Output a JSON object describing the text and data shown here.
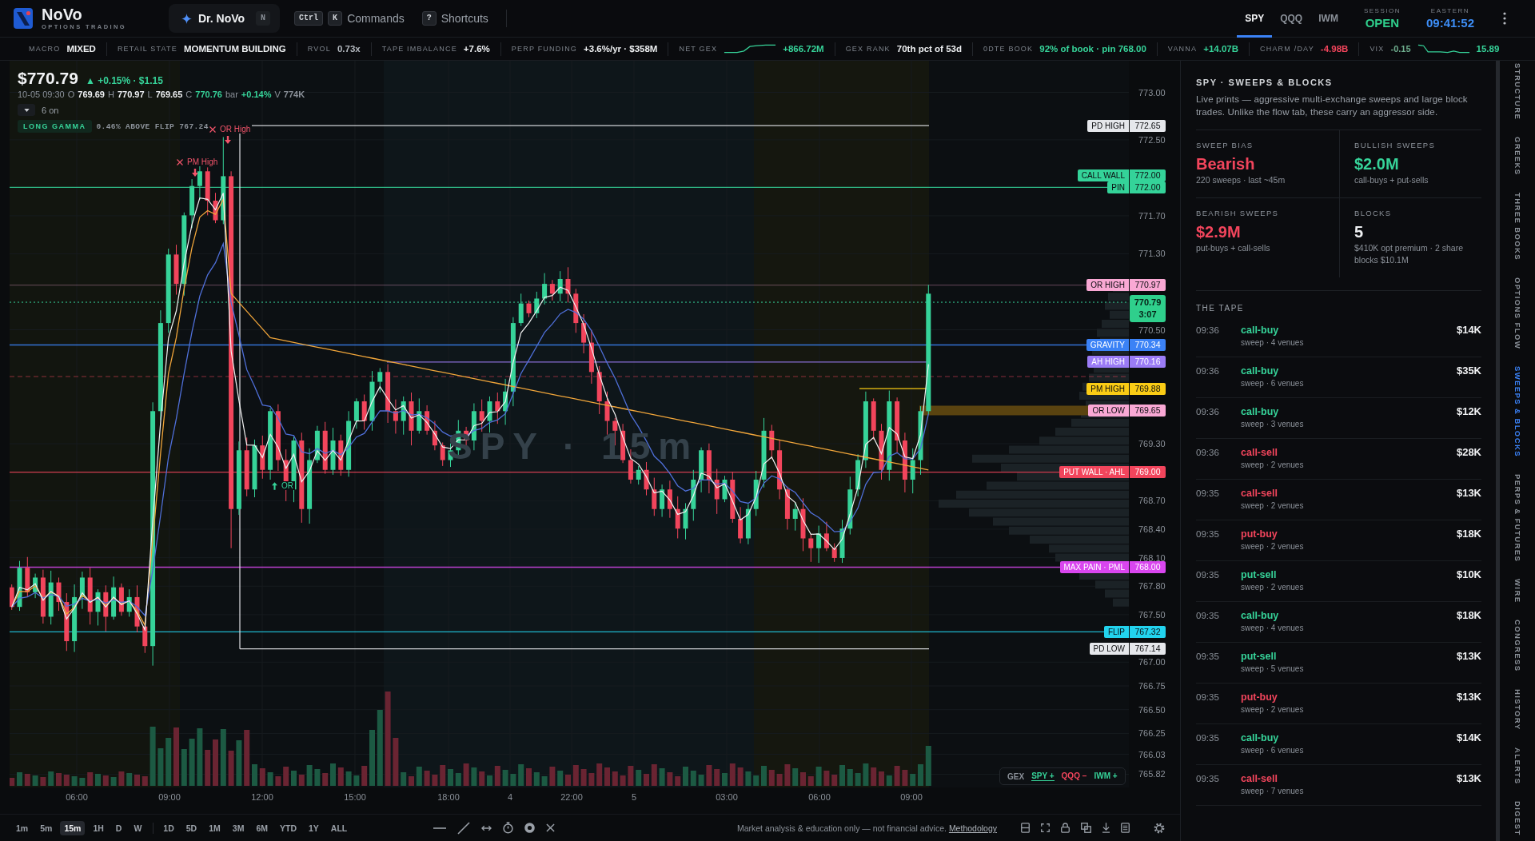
{
  "header": {
    "app_name": "NoVo",
    "app_tagline": "OPTIONS TRADING",
    "assistant": {
      "label": "Dr. NoVo",
      "shortcut": "N"
    },
    "command_palette": {
      "keys": [
        "Ctrl",
        "K"
      ],
      "label": "Commands"
    },
    "shortcuts": {
      "key": "?",
      "label": "Shortcuts"
    },
    "symbols": [
      {
        "label": "SPY",
        "selected": true
      },
      {
        "label": "QQQ",
        "selected": false
      },
      {
        "label": "IWM",
        "selected": false
      }
    ],
    "session": {
      "label": "SESSION",
      "value": "OPEN"
    },
    "clock": {
      "label": "EASTERN",
      "value": "09:41:52"
    }
  },
  "ticker_strip": [
    {
      "kind": "stat",
      "label": "MACRO",
      "value": "MIXED",
      "color": "#eef0f2"
    },
    {
      "kind": "stat",
      "label": "RETAIL STATE",
      "value": "MOMENTUM BUILDING",
      "color": "#eef0f2"
    },
    {
      "kind": "stat",
      "label": "RVOL",
      "value": "0.73x",
      "color": "#b4b9bf"
    },
    {
      "kind": "stat",
      "label": "TAPE IMBALANCE",
      "value": "+7.6%",
      "color": "#eef0f2"
    },
    {
      "kind": "stat",
      "label": "PERP FUNDING",
      "value": "+3.6%/yr · $358M",
      "color": "#eef0f2"
    },
    {
      "kind": "sparkline",
      "label": "NET GEX",
      "value": "+866.72M",
      "color": "#36d399"
    },
    {
      "kind": "stat",
      "label": "GEX RANK",
      "value": "70th pct of 53d",
      "color": "#eef0f2"
    },
    {
      "kind": "stat",
      "label": "0DTE BOOK",
      "value": "92% of book · pin 768.00",
      "color": "#36d399"
    },
    {
      "kind": "stat",
      "label": "VANNA",
      "value": "+14.07B",
      "color": "#36d399"
    },
    {
      "kind": "stat",
      "label": "CHARM /DAY",
      "value": "-4.98B",
      "color": "#f2455c"
    },
    {
      "kind": "sparkline",
      "label": "VIX",
      "change": "-0.15",
      "value": "15.89",
      "color": "#36d399"
    }
  ],
  "chart": {
    "quote": {
      "price": "$770.79",
      "change": "▲ +0.15% · $1.15",
      "color": "#36d399"
    },
    "bar_info": {
      "time": "10-05 09:30",
      "fields": [
        {
          "label": "O",
          "value": "769.69",
          "color": "#eef0f2"
        },
        {
          "label": "H",
          "value": "770.97",
          "color": "#eef0f2"
        },
        {
          "label": "L",
          "value": "769.65",
          "color": "#eef0f2"
        },
        {
          "label": "C",
          "value": "770.76",
          "color": "#36d399"
        },
        {
          "label": "bar",
          "value": "+0.14%",
          "color": "#36d399"
        },
        {
          "label": "V",
          "value": "774K",
          "color": "#8b9199"
        }
      ]
    },
    "indicators": {
      "count": "6 on"
    },
    "gamma": {
      "badge": "LONG GAMMA",
      "note": "0.46% ABOVE FLIP 767.24"
    },
    "watermark": "SPY · 15m",
    "annotations": [
      {
        "label": "PM High",
        "kind": "high"
      },
      {
        "label": "OR High",
        "kind": "high"
      },
      {
        "label": "OR",
        "kind": "low"
      }
    ],
    "levels": [
      {
        "label": "PD HIGH",
        "price": "772.65",
        "color": "#e5e7eb",
        "kind": "range"
      },
      {
        "label": "CALL WALL",
        "price": "772.00",
        "color": "#34d399",
        "kind": "full"
      },
      {
        "label": "PIN",
        "price": "772.00",
        "color": "#34d399",
        "kind": "full"
      },
      {
        "label": "OR HIGH",
        "price": "770.97",
        "color": "#f9a8d4",
        "kind": "faint"
      },
      {
        "label": "GRAVITY",
        "price": "770.34",
        "color": "#3b82f6",
        "kind": "full"
      },
      {
        "label": "AH HIGH",
        "price": "770.16",
        "color": "#9b7cf6",
        "kind": "partial"
      },
      {
        "label": "PM HIGH",
        "price": "769.88",
        "color": "#facc15",
        "kind": "segment"
      },
      {
        "label": "OR LOW",
        "price": "769.65",
        "color": "#f9a8d4",
        "kind": "band"
      },
      {
        "label": "PUT WALL · AHL",
        "price": "769.00",
        "color": "#f2455c",
        "kind": "full"
      },
      {
        "label": "MAX PAIN · PML",
        "price": "768.00",
        "color": "#d946ef",
        "kind": "full"
      },
      {
        "label": "FLIP",
        "price": "767.32",
        "color": "#22d3ee",
        "kind": "full"
      },
      {
        "label": "PD LOW",
        "price": "767.14",
        "color": "#e5e7eb",
        "kind": "range"
      }
    ],
    "last_price": {
      "value": "770.79",
      "countdown": "3:07"
    },
    "price_ticks": [
      "773.00",
      "772.50",
      "771.70",
      "771.30",
      "770.50",
      "769.30",
      "768.70",
      "768.40",
      "768.10",
      "767.80",
      "767.50",
      "767.00",
      "766.75",
      "766.50",
      "766.25",
      "766.03",
      "765.82"
    ],
    "time_ticks": [
      "06:00",
      "09:00",
      "12:00",
      "15:00",
      "18:00",
      "4",
      "22:00",
      "5",
      "03:00",
      "06:00",
      "09:00"
    ],
    "gex_legend": {
      "label": "GEX",
      "items": [
        {
          "symbol": "SPY",
          "sign": "+",
          "color": "#36d399",
          "selected": true
        },
        {
          "symbol": "QQQ",
          "sign": "−",
          "color": "#f2455c",
          "selected": false
        },
        {
          "symbol": "IWM",
          "sign": "+",
          "color": "#36d399",
          "selected": false
        }
      ]
    }
  },
  "toolbar": {
    "timeframes": [
      {
        "label": "1m",
        "selected": false
      },
      {
        "label": "5m",
        "selected": false
      },
      {
        "label": "15m",
        "selected": true
      },
      {
        "label": "1H",
        "selected": false
      },
      {
        "label": "D",
        "selected": false
      },
      {
        "label": "W",
        "selected": false
      }
    ],
    "ranges": [
      {
        "label": "1D",
        "selected": false
      },
      {
        "label": "5D",
        "selected": false
      },
      {
        "label": "1M",
        "selected": false
      },
      {
        "label": "3M",
        "selected": false
      },
      {
        "label": "6M",
        "selected": false
      },
      {
        "label": "YTD",
        "selected": false
      },
      {
        "label": "1Y",
        "selected": false
      },
      {
        "label": "ALL",
        "selected": false
      }
    ],
    "disclaimer": "Market analysis & education only — not financial advice.",
    "link": "Methodology"
  },
  "sweeps_panel": {
    "title": "SPY · SWEEPS & BLOCKS",
    "description": "Live prints — aggressive multi-exchange sweeps and large block trades. Unlike the flow tab, these carry an aggressor side.",
    "stats": [
      {
        "label": "SWEEP BIAS",
        "value": "Bearish",
        "note": "220 sweeps · last ~45m",
        "color": "#f2455c"
      },
      {
        "label": "BULLISH SWEEPS",
        "value": "$2.0M",
        "note": "call-buys + put-sells",
        "color": "#36d399"
      },
      {
        "label": "BEARISH SWEEPS",
        "value": "$2.9M",
        "note": "put-buys + call-sells",
        "color": "#f2455c"
      },
      {
        "label": "BLOCKS",
        "value": "5",
        "note": "$410K opt premium · 2 share blocks $10.1M",
        "color": "#eef0f2"
      }
    ],
    "tape_title": "THE TAPE",
    "tape": [
      {
        "time": "09:36",
        "type": "call-buy",
        "detail": "sweep · 4 venues",
        "amount": "$14K",
        "color": "#36d399"
      },
      {
        "time": "09:36",
        "type": "call-buy",
        "detail": "sweep · 6 venues",
        "amount": "$35K",
        "color": "#36d399"
      },
      {
        "time": "09:36",
        "type": "call-buy",
        "detail": "sweep · 3 venues",
        "amount": "$12K",
        "color": "#36d399"
      },
      {
        "time": "09:36",
        "type": "call-sell",
        "detail": "sweep · 2 venues",
        "amount": "$28K",
        "color": "#f2455c"
      },
      {
        "time": "09:35",
        "type": "call-sell",
        "detail": "sweep · 2 venues",
        "amount": "$13K",
        "color": "#f2455c"
      },
      {
        "time": "09:35",
        "type": "put-buy",
        "detail": "sweep · 2 venues",
        "amount": "$18K",
        "color": "#f2455c"
      },
      {
        "time": "09:35",
        "type": "put-sell",
        "detail": "sweep · 2 venues",
        "amount": "$10K",
        "color": "#36d399"
      },
      {
        "time": "09:35",
        "type": "call-buy",
        "detail": "sweep · 4 venues",
        "amount": "$18K",
        "color": "#36d399"
      },
      {
        "time": "09:35",
        "type": "put-sell",
        "detail": "sweep · 5 venues",
        "amount": "$13K",
        "color": "#36d399"
      },
      {
        "time": "09:35",
        "type": "put-buy",
        "detail": "sweep · 2 venues",
        "amount": "$13K",
        "color": "#f2455c"
      },
      {
        "time": "09:35",
        "type": "call-buy",
        "detail": "sweep · 6 venues",
        "amount": "$14K",
        "color": "#36d399"
      },
      {
        "time": "09:35",
        "type": "call-sell",
        "detail": "sweep · 7 venues",
        "amount": "$13K",
        "color": "#f2455c"
      }
    ]
  },
  "side_tabs": [
    {
      "label": "STRUCTURE",
      "selected": false
    },
    {
      "label": "GREEKS",
      "selected": false
    },
    {
      "label": "THREE BOOKS",
      "selected": false
    },
    {
      "label": "OPTIONS FLOW",
      "selected": false
    },
    {
      "label": "SWEEPS & BLOCKS",
      "selected": true
    },
    {
      "label": "PERPS & FUTURES",
      "selected": false
    },
    {
      "label": "WIRE",
      "selected": false
    },
    {
      "label": "CONGRESS",
      "selected": false
    },
    {
      "label": "HISTORY",
      "selected": false
    },
    {
      "label": "ALERTS",
      "selected": false
    },
    {
      "label": "DIGEST",
      "selected": false
    }
  ]
}
